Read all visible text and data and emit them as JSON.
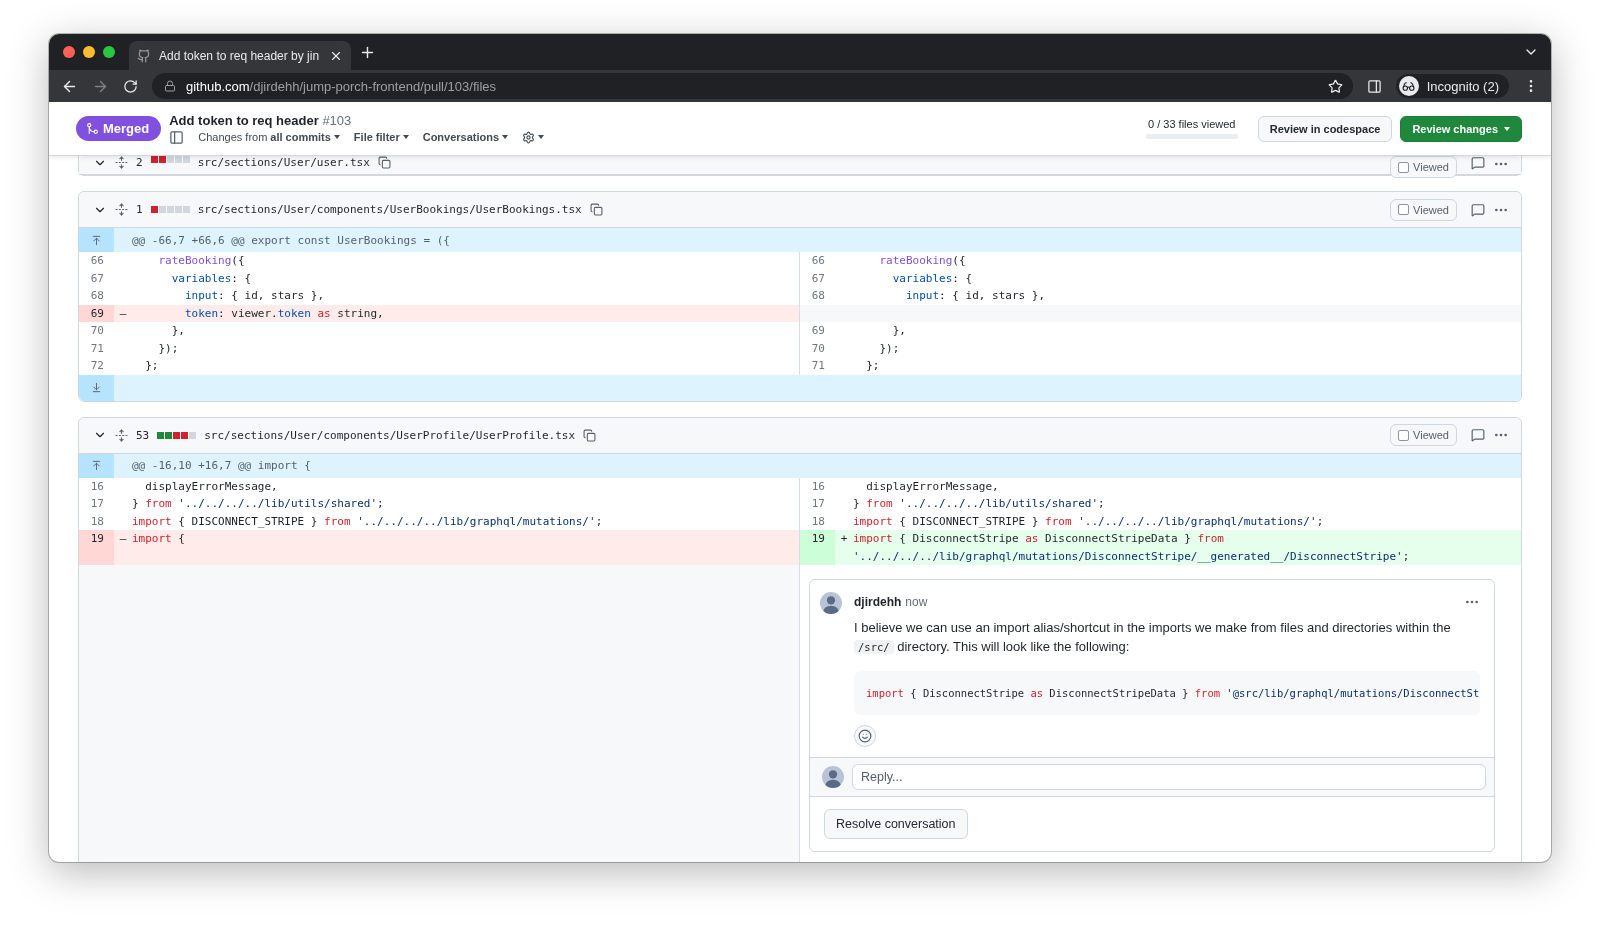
{
  "browser": {
    "tab_title": "Add token to req header by jin",
    "url_host": "github.com",
    "url_path": "/djirdehh/jump-porch-frontend/pull/103/files",
    "profile": "Incognito (2)"
  },
  "pr": {
    "state": "Merged",
    "title": "Add token to req header",
    "number": "#103",
    "changes_prefix": "Changes from",
    "changes_value": "all commits",
    "filters": [
      "File filter",
      "Conversations"
    ],
    "files_viewed": "0 / 33 files viewed",
    "level": 0,
    "buttons": [
      {
        "label": "Review in codespace",
        "kind": "secondary"
      },
      {
        "label": "Review changes",
        "kind": "primary"
      }
    ]
  },
  "files": [
    {
      "kind": "clipped",
      "changes": "2",
      "blocks": [
        {
          "color": "#cf222e"
        },
        {
          "color": "#cf222e"
        },
        {
          "color": "#d0d7de"
        },
        {
          "color": "#d0d7de"
        },
        {
          "color": "#d0d7de"
        }
      ],
      "path": "src/sections/User/user.tsx",
      "viewed": {
        "label": "Viewed",
        "checked": false
      }
    },
    {
      "kind": "full",
      "changes": "1",
      "blocks": [
        {
          "color": "#cf222e"
        },
        {
          "color": "#d0d7de"
        },
        {
          "color": "#d0d7de"
        },
        {
          "color": "#d0d7de"
        },
        {
          "color": "#d0d7de"
        }
      ],
      "path": "src/sections/User/components/UserBookings/UserBookings.tsx",
      "viewed": {
        "label": "Viewed",
        "checked": false
      },
      "hunk": "@@ -66,7 +66,6 @@ export const UserBookings = ({",
      "expand_below": true,
      "rows": [
        {
          "left": {
            "kind": "context",
            "num": "66",
            "tokens": [
              {
                "kind": "fn",
                "text": "    rateBooking"
              },
              {
                "kind": "plain",
                "text": "({"
              }
            ]
          },
          "right": {
            "kind": "context",
            "num": "66",
            "tokens": [
              {
                "kind": "fn",
                "text": "    rateBooking"
              },
              {
                "kind": "plain",
                "text": "({"
              }
            ]
          }
        },
        {
          "left": {
            "kind": "context",
            "num": "67",
            "tokens": [
              {
                "kind": "prop",
                "text": "      variables"
              },
              {
                "kind": "plain",
                "text": ": {"
              }
            ]
          },
          "right": {
            "kind": "context",
            "num": "67",
            "tokens": [
              {
                "kind": "prop",
                "text": "      variables"
              },
              {
                "kind": "plain",
                "text": ": {"
              }
            ]
          }
        },
        {
          "left": {
            "kind": "context",
            "num": "68",
            "tokens": [
              {
                "kind": "prop",
                "text": "        input"
              },
              {
                "kind": "plain",
                "text": ": { id, stars },"
              }
            ]
          },
          "right": {
            "kind": "context",
            "num": "68",
            "tokens": [
              {
                "kind": "prop",
                "text": "        input"
              },
              {
                "kind": "plain",
                "text": ": { id, stars },"
              }
            ]
          }
        },
        {
          "left": {
            "kind": "del",
            "num": "69",
            "marker": "–",
            "tokens": [
              {
                "kind": "prop",
                "text": "        token"
              },
              {
                "kind": "plain",
                "text": ": viewer."
              },
              {
                "kind": "prop",
                "text": "token"
              },
              {
                "kind": "kw",
                "text": " as"
              },
              {
                "kind": "plain",
                "text": " string,"
              }
            ]
          },
          "right": {
            "kind": "empty"
          }
        },
        {
          "left": {
            "kind": "context",
            "num": "70",
            "tokens": [
              {
                "kind": "plain",
                "text": "      },"
              }
            ]
          },
          "right": {
            "kind": "context",
            "num": "69",
            "tokens": [
              {
                "kind": "plain",
                "text": "      },"
              }
            ]
          }
        },
        {
          "left": {
            "kind": "context",
            "num": "71",
            "tokens": [
              {
                "kind": "plain",
                "text": "    });"
              }
            ]
          },
          "right": {
            "kind": "context",
            "num": "70",
            "tokens": [
              {
                "kind": "plain",
                "text": "    });"
              }
            ]
          }
        },
        {
          "left": {
            "kind": "context",
            "num": "72",
            "tokens": [
              {
                "kind": "plain",
                "text": "  };"
              }
            ]
          },
          "right": {
            "kind": "context",
            "num": "71",
            "tokens": [
              {
                "kind": "plain",
                "text": "  };"
              }
            ]
          }
        }
      ]
    },
    {
      "kind": "full",
      "changes": "53",
      "blocks": [
        {
          "color": "#1f883d"
        },
        {
          "color": "#1f883d"
        },
        {
          "color": "#cf222e"
        },
        {
          "color": "#cf222e"
        },
        {
          "color": "#d0d7de"
        }
      ],
      "path": "src/sections/User/components/UserProfile/UserProfile.tsx",
      "viewed": {
        "label": "Viewed",
        "checked": false
      },
      "hunk": "@@ -16,10 +16,7 @@ import {",
      "rows": [
        {
          "left": {
            "kind": "context",
            "num": "16",
            "tokens": [
              {
                "kind": "plain",
                "text": "  displayErrorMessage,"
              }
            ]
          },
          "right": {
            "kind": "context",
            "num": "16",
            "tokens": [
              {
                "kind": "plain",
                "text": "  displayErrorMessage,"
              }
            ]
          }
        },
        {
          "left": {
            "kind": "context",
            "num": "17",
            "tokens": [
              {
                "kind": "plain",
                "text": "} "
              },
              {
                "kind": "kw",
                "text": "from"
              },
              {
                "kind": "str",
                "text": " '../../../../lib/utils/shared'"
              },
              {
                "kind": "plain",
                "text": ";"
              }
            ]
          },
          "right": {
            "kind": "context",
            "num": "17",
            "tokens": [
              {
                "kind": "plain",
                "text": "} "
              },
              {
                "kind": "kw",
                "text": "from"
              },
              {
                "kind": "str",
                "text": " '../../../../lib/utils/shared'"
              },
              {
                "kind": "plain",
                "text": ";"
              }
            ]
          }
        },
        {
          "left": {
            "kind": "context",
            "num": "18",
            "tokens": [
              {
                "kind": "kw",
                "text": "import"
              },
              {
                "kind": "plain",
                "text": " { DISCONNECT_STRIPE } "
              },
              {
                "kind": "kw",
                "text": "from"
              },
              {
                "kind": "str",
                "text": " '../../../../lib/graphql/mutations/'"
              },
              {
                "kind": "plain",
                "text": ";"
              }
            ]
          },
          "right": {
            "kind": "context",
            "num": "18",
            "tokens": [
              {
                "kind": "kw",
                "text": "import"
              },
              {
                "kind": "plain",
                "text": " { DISCONNECT_STRIPE } "
              },
              {
                "kind": "kw",
                "text": "from"
              },
              {
                "kind": "str",
                "text": " '../../../../lib/graphql/mutations/'"
              },
              {
                "kind": "plain",
                "text": ";"
              }
            ]
          }
        },
        {
          "left": {
            "kind": "del",
            "num": "19",
            "marker": "–",
            "tokens": [
              {
                "kind": "kw",
                "text": "import"
              },
              {
                "kind": "plain",
                "text": " {"
              }
            ]
          },
          "right": {
            "kind": "add",
            "num": "19",
            "marker": "+",
            "tokens": [
              {
                "kind": "kw",
                "text": "import"
              },
              {
                "kind": "plain",
                "text": " { DisconnectStripe "
              },
              {
                "kind": "kw",
                "text": "as"
              },
              {
                "kind": "plain",
                "text": " DisconnectStripeData } "
              },
              {
                "kind": "kw",
                "text": "from"
              },
              {
                "kind": "str",
                "text": " '../../../../lib/graphql/mutations/DisconnectStripe/__generated__/DisconnectStripe'"
              },
              {
                "kind": "plain",
                "text": ";"
              }
            ]
          }
        }
      ],
      "thread": {
        "author": "djirdehh",
        "time": "now",
        "body": [
          {
            "kind": "text",
            "text": "I believe we can use an import alias/shortcut in the imports we make from files and directories within the "
          },
          {
            "kind": "code",
            "text": "/src/"
          },
          {
            "kind": "text",
            "text": " directory. This will look like the following:"
          }
        ],
        "code": [
          {
            "kind": "kw",
            "text": "import"
          },
          {
            "kind": "plain",
            "text": " { DisconnectStripe "
          },
          {
            "kind": "kw",
            "text": "as"
          },
          {
            "kind": "plain",
            "text": " DisconnectStripeData } "
          },
          {
            "kind": "kw",
            "text": "from"
          },
          {
            "kind": "str",
            "text": " '@src/lib/graphql/mutations/DisconnectSt"
          }
        ],
        "reply_placeholder": "Reply...",
        "resolve": "Resolve conversation"
      }
    }
  ]
}
